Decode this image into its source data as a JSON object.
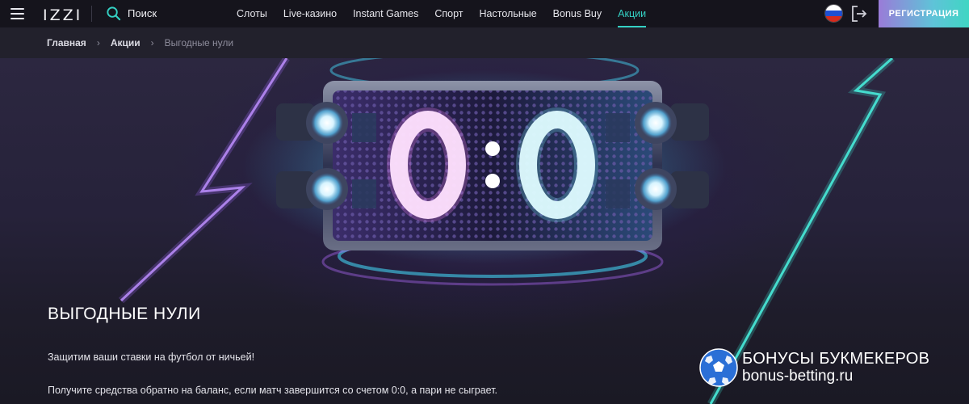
{
  "header": {
    "logo": "IZZI",
    "search_label": "Поиск",
    "nav": [
      "Слоты",
      "Live-казино",
      "Instant Games",
      "Спорт",
      "Настольные",
      "Bonus Buy",
      "Акции"
    ],
    "active_nav": "Акции",
    "register_label": "РЕГИСТРАЦИЯ",
    "language_flag": "ru-flag-icon"
  },
  "breadcrumbs": [
    "Главная",
    "Акции",
    "Выгодные нули"
  ],
  "hero": {
    "scoreboard_text": "0:0",
    "title": "ВЫГОДНЫЕ НУЛИ",
    "text1": "Защитим ваши ставки на футбол от ничьей!",
    "text2": "Получите средства обратно на баланс, если матч завершится со счетом 0:0, а пари не сыграет."
  },
  "watermark": {
    "line1": "БОНУСЫ БУКМЕКЕРОВ",
    "line2": "bonus-betting.ru"
  },
  "colors": {
    "accent": "#34d1c4",
    "register_gradient_start": "#9a7bd8",
    "register_gradient_end": "#3fd6c3",
    "background": "#1b1a24"
  }
}
